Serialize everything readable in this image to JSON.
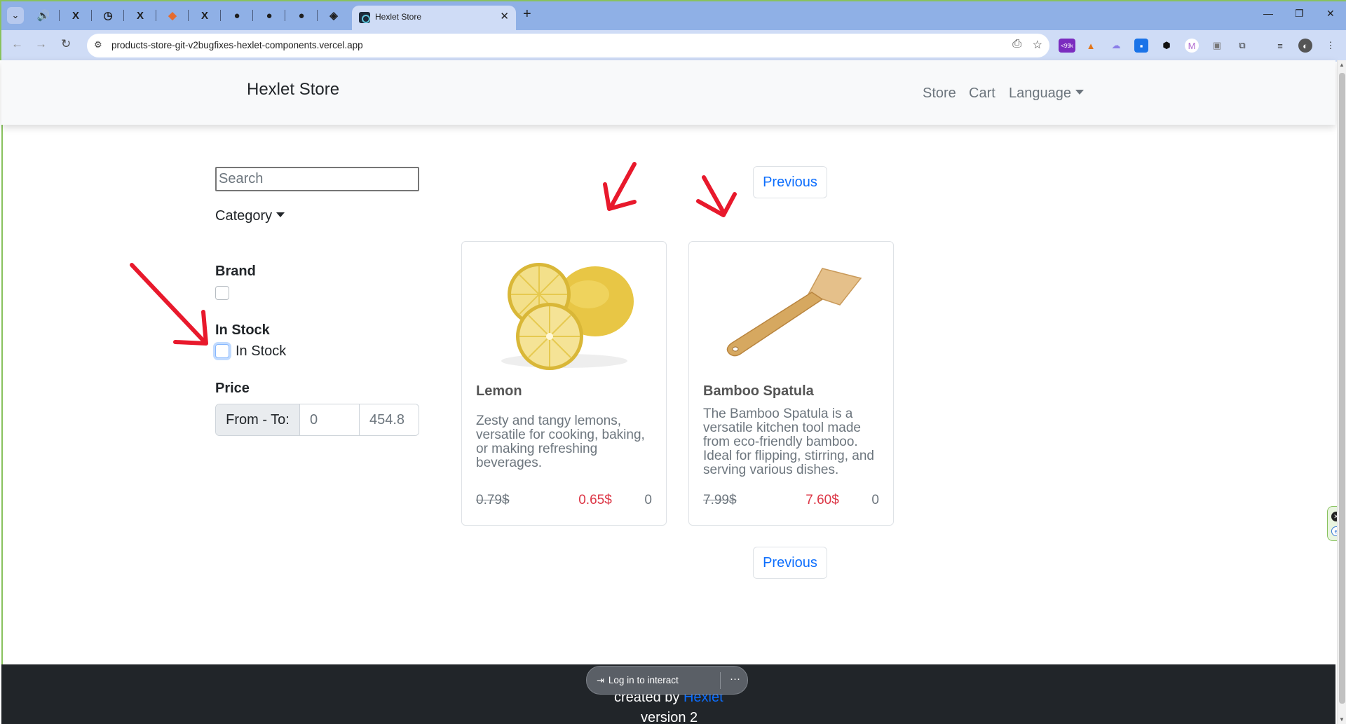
{
  "browser": {
    "tab_title": "Hexlet Store",
    "url": "products-store-git-v2bugfixes-hexlet-components.vercel.app",
    "extension_badge": "<99k"
  },
  "navbar": {
    "brand": "Hexlet Store",
    "links": [
      "Store",
      "Cart",
      "Language"
    ]
  },
  "filters": {
    "search_placeholder": "Search",
    "category_label": "Category",
    "brand_label": "Brand",
    "stock_label": "In Stock",
    "stock_checkbox_label": "In Stock",
    "price_label": "Price",
    "price_addon": "From - To:",
    "price_from": "0",
    "price_to": "454.8"
  },
  "pagination": {
    "previous_label": "Previous"
  },
  "products": [
    {
      "name": "Lemon",
      "description": "Zesty and tangy lemons, versatile for cooking, baking, or making refreshing beverages.",
      "old_price": "0.79$",
      "price": "0.65$",
      "count": "0",
      "image_icon": "lemon-image"
    },
    {
      "name": "Bamboo Spatula",
      "description": "The Bamboo Spatula is a versatile kitchen tool made from eco-friendly bamboo. Ideal for flipping, stirring, and serving various dishes.",
      "old_price": "7.99$",
      "price": "7.60$",
      "count": "0",
      "image_icon": "spatula-image"
    }
  ],
  "footer": {
    "created_by": "created by",
    "creator_link": "Hexlet",
    "version": "version 2"
  },
  "overlay": {
    "login_label": "Log in to interact",
    "more_label": "···"
  },
  "colors": {
    "link": "#0d6efd",
    "sale_price": "#dc3545",
    "annotation_arrow": "#e8192c",
    "footer_bg": "#212529"
  }
}
